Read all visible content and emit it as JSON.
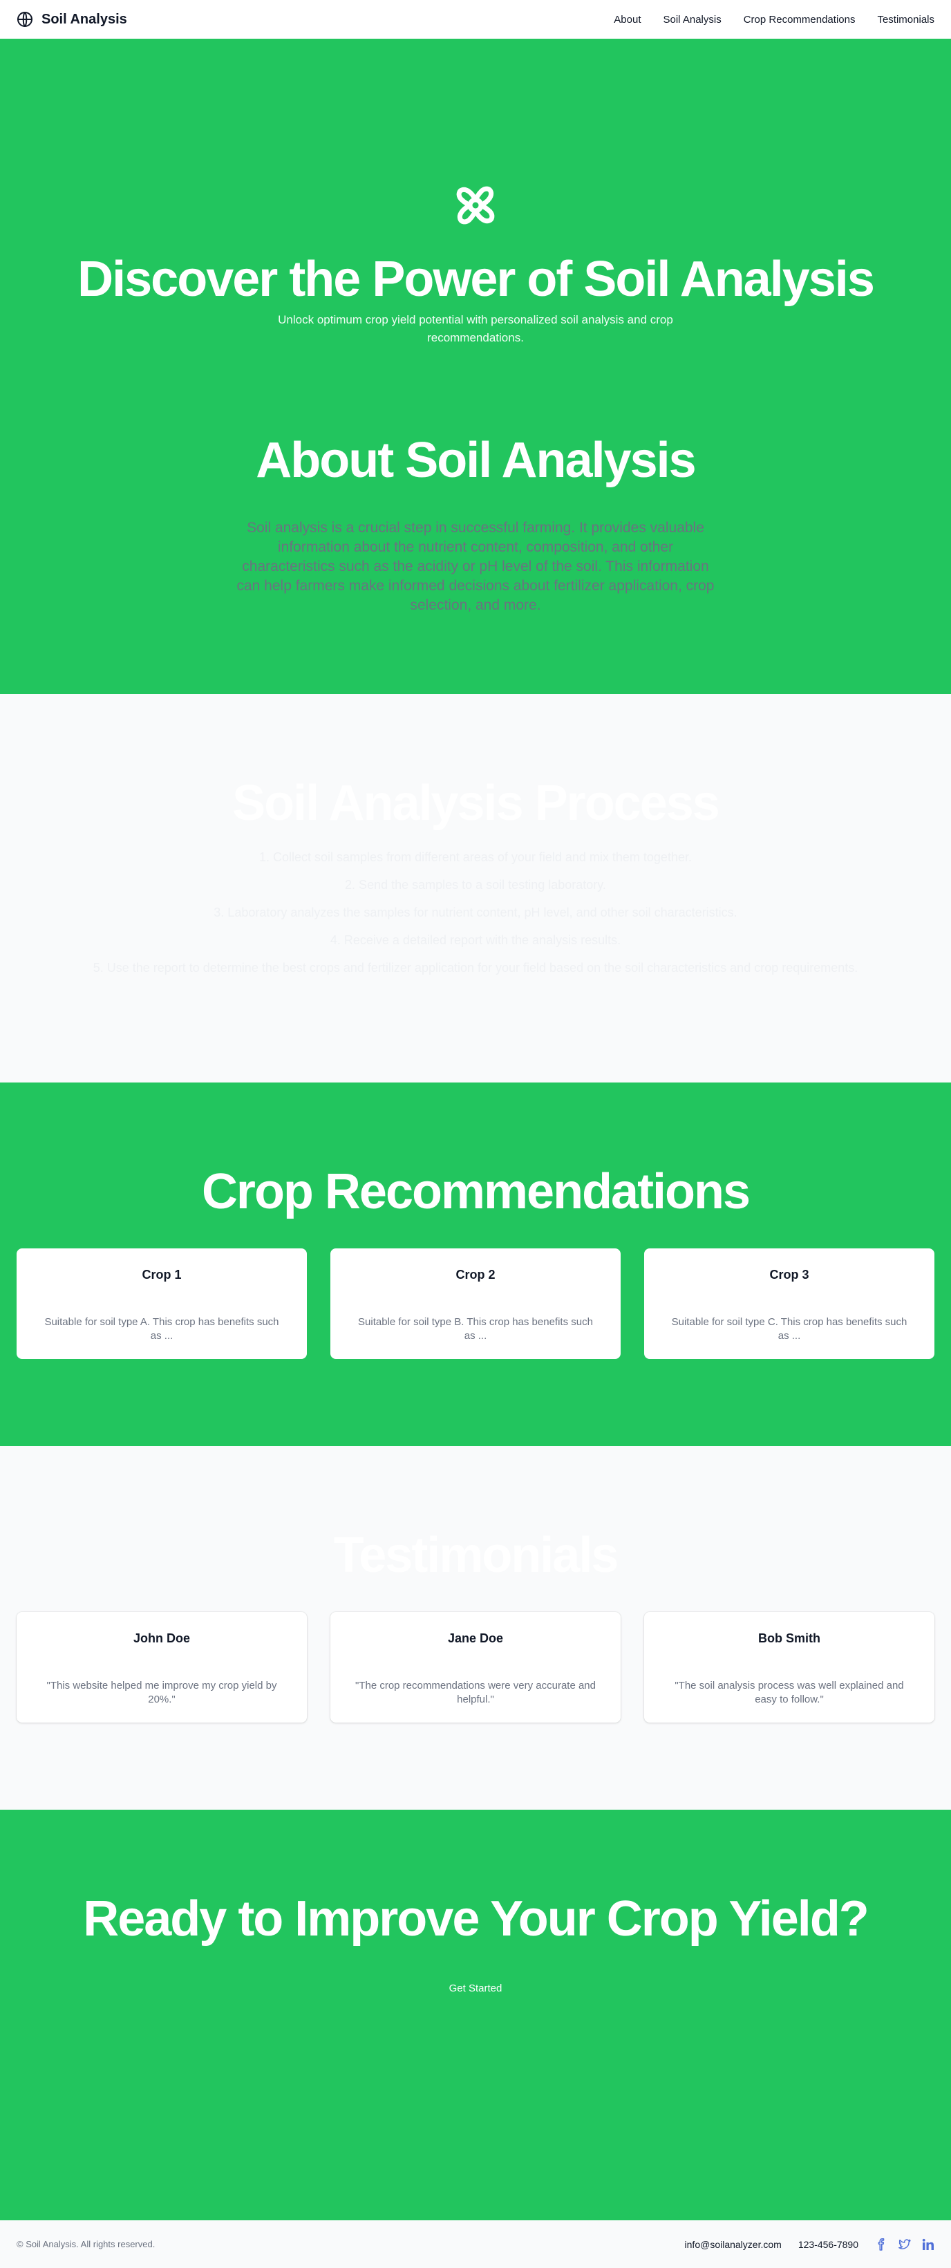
{
  "header": {
    "brand_icon": "globe-icon",
    "brand_name": "Soil Analysis",
    "nav": [
      "About",
      "Soil Analysis",
      "Crop Recommendations",
      "Testimonials"
    ]
  },
  "hero": {
    "icon": "flower-icon",
    "title": "Discover the Power of Soil Analysis",
    "subtitle": "Unlock optimum crop yield potential with personalized soil analysis and crop recommendations."
  },
  "about": {
    "title": "About Soil Analysis",
    "text": "Soil analysis is a crucial step in successful farming. It provides valuable information about the nutrient content, composition, and other characteristics such as the acidity or pH level of the soil. This information can help farmers make informed decisions about fertilizer application, crop selection, and more."
  },
  "process": {
    "title": "Soil Analysis Process",
    "steps": [
      "1. Collect soil samples from different areas of your field and mix them together.",
      "2. Send the samples to a soil testing laboratory.",
      "3. Laboratory analyzes the samples for nutrient content, pH level, and other soil characteristics.",
      "4. Receive a detailed report with the analysis results.",
      "5. Use the report to determine the best crops and fertilizer application for your field based on the soil characteristics and crop requirements."
    ]
  },
  "crops": {
    "title": "Crop Recommendations",
    "cards": [
      {
        "title": "Crop 1",
        "text": "Suitable for soil type A. This crop has benefits such as ..."
      },
      {
        "title": "Crop 2",
        "text": "Suitable for soil type B. This crop has benefits such as ..."
      },
      {
        "title": "Crop 3",
        "text": "Suitable for soil type C. This crop has benefits such as ..."
      }
    ]
  },
  "testimonials": {
    "title": "Testimonials",
    "cards": [
      {
        "name": "John Doe",
        "quote": "\"This website helped me improve my crop yield by 20%.\""
      },
      {
        "name": "Jane Doe",
        "quote": "\"The crop recommendations were very accurate and helpful.\""
      },
      {
        "name": "Bob Smith",
        "quote": "\"The soil analysis process was well explained and easy to follow.\""
      }
    ]
  },
  "cta": {
    "title": "Ready to Improve Your Crop Yield?",
    "button": "Get Started"
  },
  "footer": {
    "copyright": "© Soil Analysis. All rights reserved.",
    "email": "info@soilanalyzer.com",
    "phone": "123-456-7890",
    "socials": [
      "facebook-icon",
      "twitter-icon",
      "linkedin-icon"
    ]
  },
  "colors": {
    "accent": "#22c55e",
    "background": "#f9fafb",
    "muted_text": "#6b7280",
    "social_icon": "#4f6fd8"
  }
}
